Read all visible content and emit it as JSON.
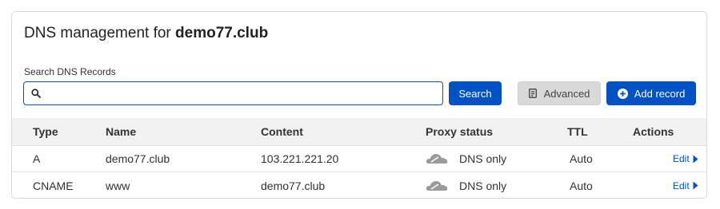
{
  "header": {
    "title_prefix": "DNS management for",
    "domain": "demo77.club"
  },
  "search": {
    "label": "Search DNS Records",
    "value": "",
    "placeholder": "",
    "button_label": "Search"
  },
  "toolbar": {
    "advanced_label": "Advanced",
    "add_record_label": "Add record"
  },
  "table": {
    "columns": [
      "Type",
      "Name",
      "Content",
      "Proxy status",
      "TTL",
      "Actions"
    ],
    "rows": [
      {
        "type": "A",
        "name": "demo77.club",
        "content": "103.221.221.20",
        "proxy_status": "DNS only",
        "ttl": "Auto",
        "action": "Edit"
      },
      {
        "type": "CNAME",
        "name": "www",
        "content": "demo77.club",
        "proxy_status": "DNS only",
        "ttl": "Auto",
        "action": "Edit"
      }
    ]
  },
  "icons": {
    "search": "search-icon",
    "advanced": "document-icon",
    "add": "plus-circle-icon",
    "proxy": "cloud-dns-only-icon",
    "edit": "caret-right-icon"
  },
  "colors": {
    "primary": "#0051c3",
    "secondary_button": "#d9d9d9",
    "header_row": "#f2f2f2",
    "cloud_gray": "#9a9a9a"
  }
}
